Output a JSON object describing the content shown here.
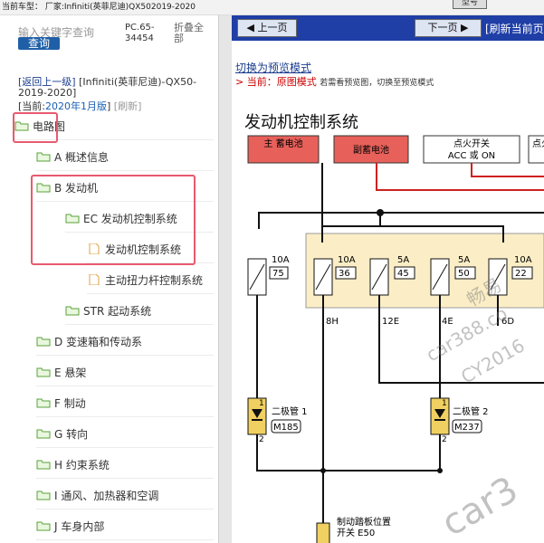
{
  "topbar": {
    "text": "当前车型： 厂家:Infiniti(英菲尼迪)QX502019-2020",
    "tab": "型号"
  },
  "sidebar": {
    "search_placeholder": "输入关键字查询",
    "query_label": "查询",
    "pc_code": "PC.65-34454",
    "fold_label": "折叠全部",
    "back_link": "[返回上一级]",
    "breadcrumb": "[Infiniti(英菲尼迪)-QX50-2019-2020]",
    "current_prefix": "[当前:",
    "current_value": "2020年1月版",
    "current_suffix": "]",
    "refresh": "[刷新]",
    "items": [
      {
        "label": "电路图",
        "type": "folder"
      },
      {
        "label": "A 概述信息",
        "type": "folder"
      },
      {
        "label": "B 发动机",
        "type": "folder"
      },
      {
        "label": "EC 发动机控制系统",
        "type": "folder"
      },
      {
        "label": "发动机控制系统",
        "type": "file"
      },
      {
        "label": "主动扭力杆控制系统",
        "type": "file"
      },
      {
        "label": "STR 起动系统",
        "type": "folder"
      },
      {
        "label": "D 变速箱和传动系",
        "type": "folder"
      },
      {
        "label": "E 悬架",
        "type": "folder"
      },
      {
        "label": "F 制动",
        "type": "folder"
      },
      {
        "label": "G 转向",
        "type": "folder"
      },
      {
        "label": "H 约束系统",
        "type": "folder"
      },
      {
        "label": "I 通风、加热器和空调",
        "type": "folder"
      },
      {
        "label": "J 车身内部",
        "type": "folder"
      }
    ]
  },
  "viewer": {
    "prev_label": "上一页",
    "next_label": "下一页",
    "refresh_label": "[刷新当前页",
    "preview_link": "切换为预览模式",
    "mode_prefix": "> 当前：",
    "mode_value": "原图模式",
    "mode_note": "若需看预览图，切换至预览模式",
    "diagram_title": "发动机控制系统"
  },
  "diagram": {
    "main_battery": "主\n蓄电池",
    "aux_battery": "副蓄电池",
    "ignition": "点火开关\nACC 或 ON",
    "right_box": "点火",
    "fuses": [
      {
        "amp": "10A",
        "num": "75"
      },
      {
        "amp": "10A",
        "num": "36"
      },
      {
        "amp": "5A",
        "num": "45"
      },
      {
        "amp": "5A",
        "num": "50"
      },
      {
        "amp": "10A",
        "num": "22"
      }
    ],
    "pins": [
      "8H",
      "12E",
      "4E",
      "6D"
    ],
    "diode1": "二极管 1",
    "diode1_conn": "M185",
    "diode2": "二极管 2",
    "diode2_conn": "M237",
    "brake_switch": "制动踏板\n位置\n开关",
    "brake_conn": "E50",
    "diode_pin1": "1",
    "diode_pin2": "2",
    "watermarks": [
      "畅易",
      "car388.co",
      "CY2016",
      "car3"
    ]
  },
  "colors": {
    "accent": "#1f3ea6",
    "highlight": "#e85a6f",
    "battery": "#e8605a",
    "relay_bg": "#fbeec6"
  }
}
